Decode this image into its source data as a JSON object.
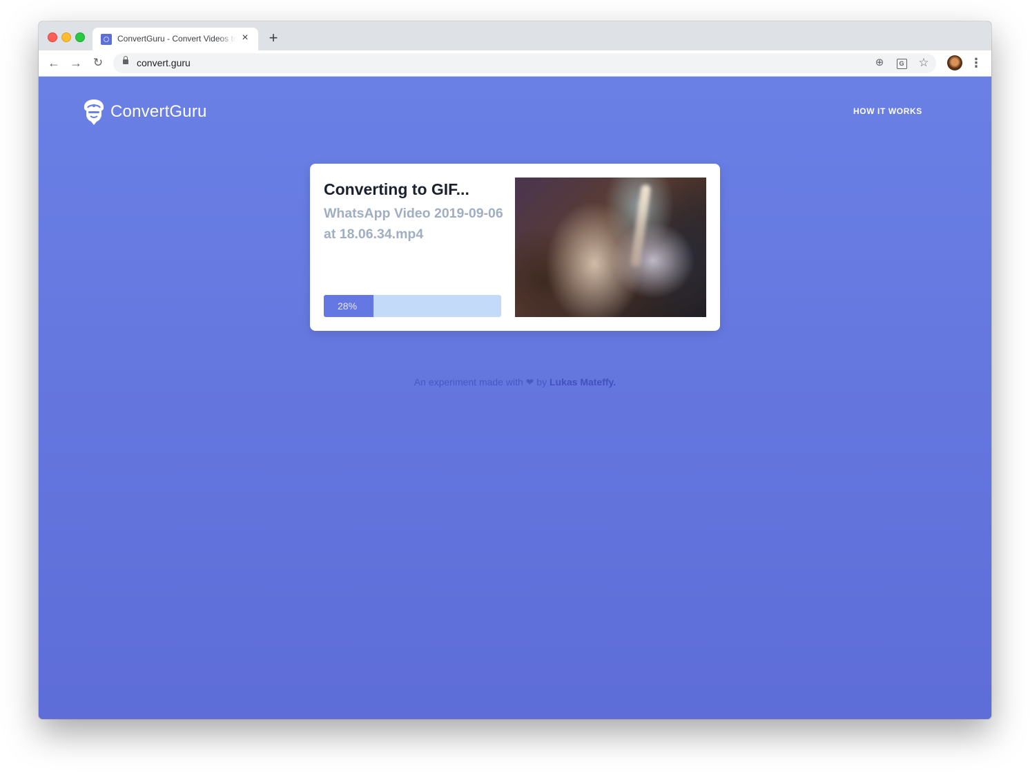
{
  "browser": {
    "tab_title": "ConvertGuru - Convert Videos to GIF",
    "tab_close_icon": "×",
    "new_tab_icon": "+",
    "url": "convert.guru",
    "back_icon": "←",
    "forward_icon": "→",
    "reload_icon": "↻",
    "add_icon": "⊕",
    "translate_icon": "G",
    "star_icon": "☆",
    "menu_icon": "⋮"
  },
  "site": {
    "brand": "ConvertGuru",
    "nav_link": "HOW IT WORKS",
    "background_color": "#6474de"
  },
  "conversion": {
    "title": "Converting to GIF...",
    "filename": "WhatsApp Video 2019-09-06 at 18.06.34.mp4",
    "progress_percent": 28,
    "progress_label": "28%",
    "progress_color": "#6577e3",
    "track_color": "#c3daf9"
  },
  "footer": {
    "prefix": "An experiment made with",
    "heart": "❤",
    "by": "by",
    "author": "Lukas Mateffy."
  }
}
